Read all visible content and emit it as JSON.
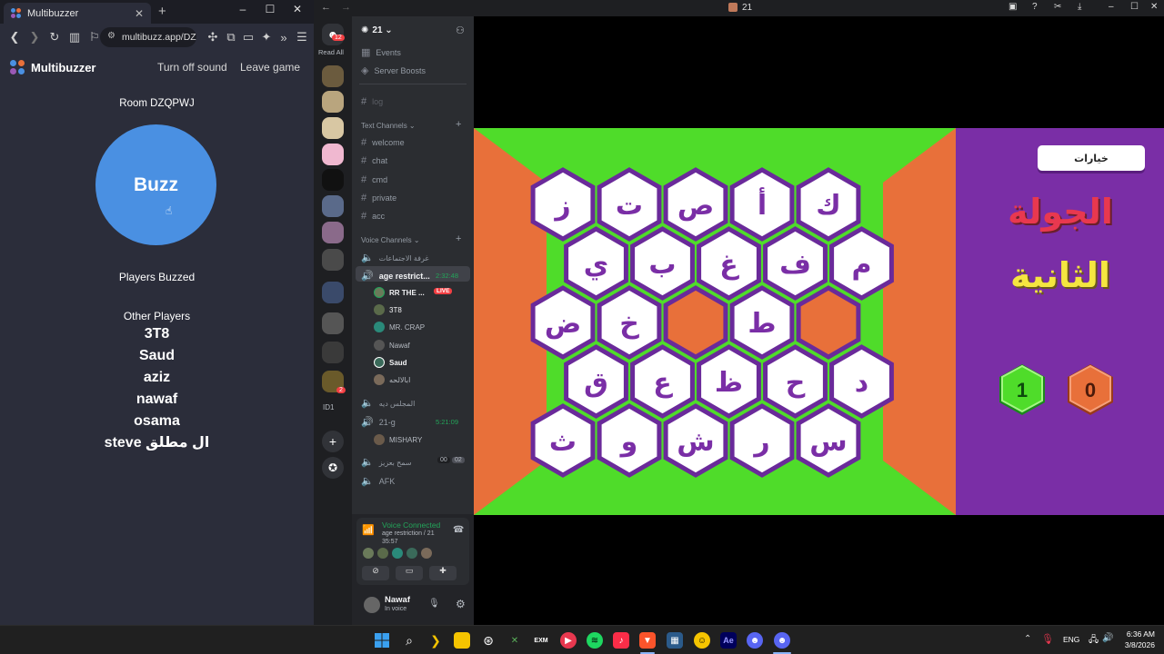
{
  "browser": {
    "tab_title": "Multibuzzer",
    "url": "multibuzz.app/DZQPWJ",
    "app_name": "Multibuzzer",
    "sound_link": "Turn off sound",
    "leave_link": "Leave game",
    "room_label": "Room DZQPWJ",
    "buzz_label": "Buzz",
    "players_buzzed_label": "Players Buzzed",
    "other_players_label": "Other Players",
    "players": [
      "3T8",
      "Saud",
      "aziz",
      "nawaf",
      "osama",
      "steve ال مطلق"
    ]
  },
  "discord": {
    "window_title": "21",
    "mentions_badge": "12",
    "read_all": "Read All",
    "server_name": "21",
    "events": "Events",
    "server_boosts": "Server Boosts",
    "log_channel": "log",
    "text_channels_label": "Text Channels",
    "text_channels": [
      "welcome",
      "chat",
      "cmd",
      "private",
      "acc"
    ],
    "voice_channels_label": "Voice Channels",
    "voice_channel_1": "غرفة الاجتماعات",
    "active_voice": {
      "name": "age restrict...",
      "timer": "2:32:48"
    },
    "voice_users": [
      "RR THE ...",
      "3T8",
      "MR. CRAP",
      "Nawaf",
      "Saud",
      "ابالالحه"
    ],
    "live_badge": "LIVE",
    "voice_channel_3": "المجلس ديه",
    "voice_21g": {
      "name": "21-g",
      "timer": "5:21:09"
    },
    "voice_21g_user": "MISHARY",
    "voice_channel_5": "سمح بعزيز",
    "voice_channel_5_counts": [
      "00",
      "02"
    ],
    "afk_channel": "AFK",
    "voice_connected": "Voice Connected",
    "voice_connected_sub": "age restriction / 21",
    "voice_connected_time": "35:57",
    "user_name": "Nawaf",
    "user_status": "In voice",
    "server_badge_2": "2",
    "server_label_idl": "ID1"
  },
  "game": {
    "choices_button": "خيارات",
    "round_title_line1": "الجولة",
    "round_title_line2": "الثانية",
    "score_green": "1",
    "score_orange": "0",
    "hex_rows": [
      [
        "ز",
        "ت",
        "ص",
        "أ",
        "ك"
      ],
      [
        "ي",
        "ب",
        "غ",
        "ف",
        "م"
      ],
      [
        "ض",
        "خ",
        "",
        "ط",
        ""
      ],
      [
        "ق",
        "ع",
        "ظ",
        "ح",
        "د"
      ],
      [
        "ث",
        "و",
        "ش",
        "ر",
        "س"
      ]
    ],
    "colors": {
      "green": "#4fdc2a",
      "orange": "#e8703a",
      "purple": "#7a2ea6",
      "hex_border": "#6a2a9a"
    }
  },
  "taskbar": {
    "lang": "ENG",
    "time": "6:36 AM",
    "date": "3/8/2026",
    "exm_label": "EXM",
    "ae_label": "Ae"
  }
}
